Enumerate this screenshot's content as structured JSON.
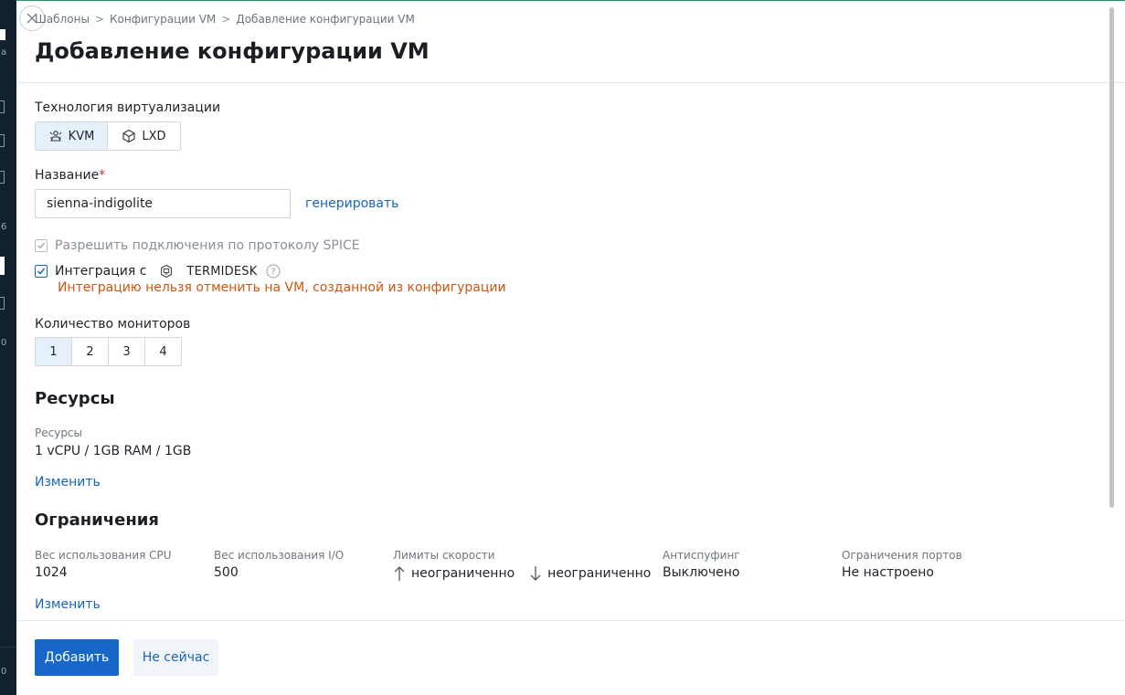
{
  "breadcrumb": {
    "items": [
      "Шаблоны",
      "Конфигурации VM",
      "Добавление конфигурации VM"
    ],
    "separator": ">"
  },
  "page_title": "Добавление конфигурации VM",
  "virtualization": {
    "label": "Технология виртуализации",
    "options": [
      {
        "label": "KVM",
        "icon": "kvm-icon",
        "selected": true
      },
      {
        "label": "LXD",
        "icon": "lxd-icon",
        "selected": false
      }
    ]
  },
  "name_field": {
    "label": "Название",
    "required_mark": "*",
    "value": "sienna-indigolite",
    "generate_link": "генерировать"
  },
  "spice": {
    "label": "Разрешить подключения по протоколу SPICE",
    "checked": true,
    "disabled": true
  },
  "integration": {
    "label_prefix": "Интеграция с",
    "product": "TERMIDESK",
    "checked": true,
    "warning": "Интеграцию нельзя отменить на VM, созданной из конфигурации"
  },
  "monitors": {
    "label": "Количество мониторов",
    "options": [
      "1",
      "2",
      "3",
      "4"
    ],
    "selected": "1"
  },
  "resources": {
    "title": "Ресурсы",
    "field_label": "Ресурсы",
    "value": "1 vCPU / 1GB RAM / 1GB",
    "edit_link": "Изменить"
  },
  "limits": {
    "title": "Ограничения",
    "cpu_weight_label": "Вес использования CPU",
    "cpu_weight_value": "1024",
    "io_weight_label": "Вес использования I/O",
    "io_weight_value": "500",
    "speed_label": "Лимиты скорости",
    "speed_up_value": "неограниченно",
    "speed_down_value": "неограниченно",
    "antispoofing_label": "Антиспуфинг",
    "antispoofing_value": "Выключено",
    "ports_label": "Ограничения портов",
    "ports_value": "Не настроено",
    "edit_link": "Изменить"
  },
  "footer": {
    "add_button": "Добавить",
    "cancel_button": "Не сейчас"
  },
  "sidebar_glyphs": [
    "a",
    "6",
    "0",
    "0"
  ],
  "colors": {
    "primary": "#1667c7",
    "link": "#1565c0",
    "warning": "#d2550e",
    "required": "#d02b2b",
    "selected_bg": "#e6f0fb",
    "sidebar_bg": "#13202e"
  }
}
